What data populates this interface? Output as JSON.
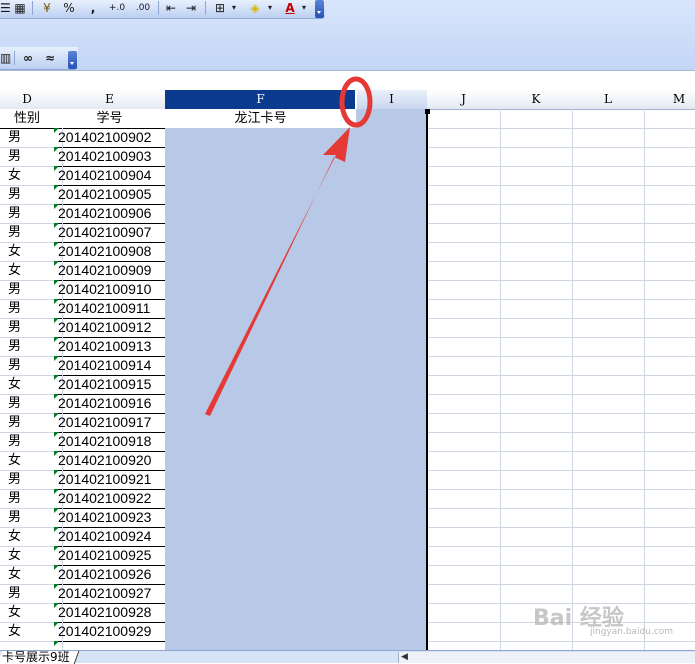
{
  "toolbar": {
    "row1_buttons": [
      "%",
      ",",
      "+.0",
      ".00"
    ],
    "font_color_letter": "A"
  },
  "columns": [
    {
      "label": "D"
    },
    {
      "label": "E"
    },
    {
      "label": "F"
    },
    {
      "label": "I"
    },
    {
      "label": "J"
    },
    {
      "label": "K"
    },
    {
      "label": "L"
    },
    {
      "label": "M"
    }
  ],
  "header_row": {
    "d": "性别",
    "e": "学号",
    "f": "龙江卡号"
  },
  "rows": [
    {
      "gender": "男",
      "id": "201402100902"
    },
    {
      "gender": "男",
      "id": "201402100903"
    },
    {
      "gender": "女",
      "id": "201402100904"
    },
    {
      "gender": "男",
      "id": "201402100905"
    },
    {
      "gender": "男",
      "id": "201402100906"
    },
    {
      "gender": "男",
      "id": "201402100907"
    },
    {
      "gender": "女",
      "id": "201402100908"
    },
    {
      "gender": "女",
      "id": "201402100909"
    },
    {
      "gender": "男",
      "id": "201402100910"
    },
    {
      "gender": "男",
      "id": "201402100911"
    },
    {
      "gender": "男",
      "id": "201402100912"
    },
    {
      "gender": "男",
      "id": "201402100913"
    },
    {
      "gender": "男",
      "id": "201402100914"
    },
    {
      "gender": "女",
      "id": "201402100915"
    },
    {
      "gender": "男",
      "id": "201402100916"
    },
    {
      "gender": "男",
      "id": "201402100917"
    },
    {
      "gender": "男",
      "id": "201402100918"
    },
    {
      "gender": "女",
      "id": "201402100920"
    },
    {
      "gender": "男",
      "id": "201402100921"
    },
    {
      "gender": "男",
      "id": "201402100922"
    },
    {
      "gender": "男",
      "id": "201402100923"
    },
    {
      "gender": "女",
      "id": "201402100924"
    },
    {
      "gender": "女",
      "id": "201402100925"
    },
    {
      "gender": "女",
      "id": "201402100926"
    },
    {
      "gender": "男",
      "id": "201402100927"
    },
    {
      "gender": "女",
      "id": "201402100928"
    },
    {
      "gender": "女",
      "id": "201402100929"
    }
  ],
  "sheet_tab": "卡号展示9班",
  "watermark": "Bai 经验",
  "watermark_url": "jingyan.baidu.com",
  "colors": {
    "selection_fill": "#b7c9e6",
    "selected_header": "#0a3b8e",
    "annotation_red": "#e53935",
    "toolbar_bg": "#c3d6f6"
  },
  "icons": [
    "paste-format-icon",
    "currency-icon",
    "percent-icon",
    "comma-icon",
    "increase-decimal-icon",
    "decrease-decimal-icon",
    "decrease-indent-icon",
    "increase-indent-icon",
    "borders-icon",
    "fill-color-icon",
    "font-color-icon",
    "toolbar-options-chevron-icon"
  ]
}
